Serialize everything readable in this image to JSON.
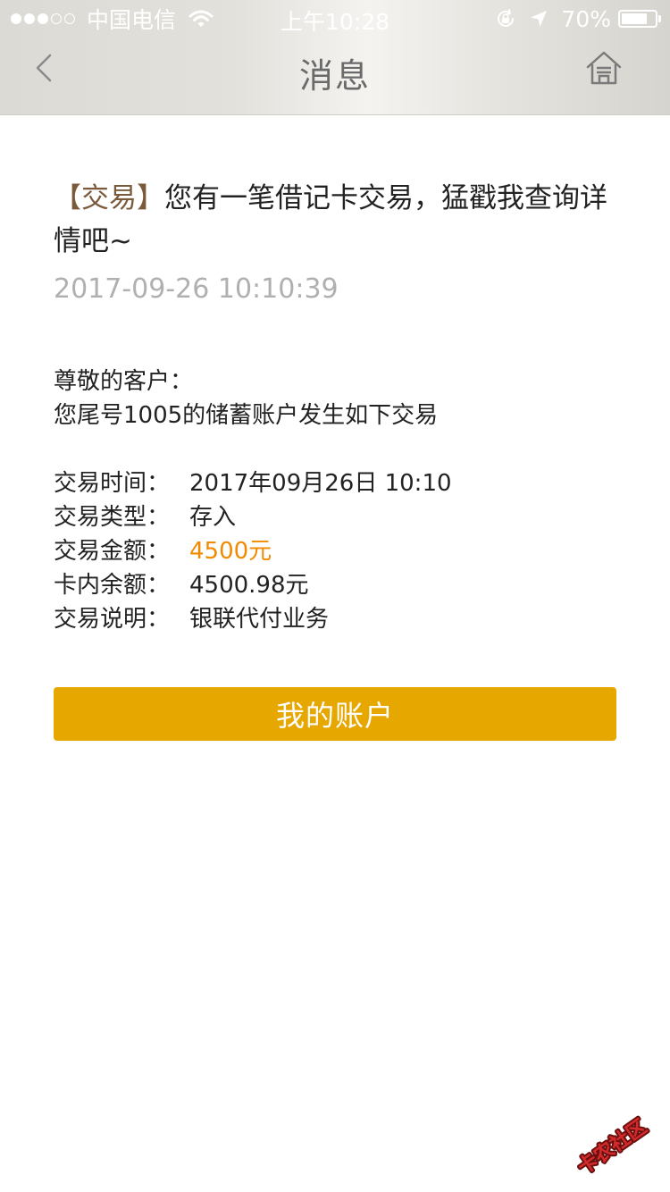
{
  "status_bar": {
    "carrier": "中国电信",
    "time": "上午10:28",
    "battery": "70%",
    "signal_bars_filled": 3,
    "signal_bars_total": 5
  },
  "nav": {
    "title": "消息",
    "back_icon": "chevron-left-icon",
    "home_icon": "home-icon"
  },
  "message": {
    "tag": "【交易】",
    "title": "您有一笔借记卡交易，猛戳我查询详情吧~",
    "time": "2017-09-26 10:10:39",
    "greeting": "尊敬的客户：",
    "intro": "您尾号1005的储蓄账户发生如下交易",
    "details": [
      {
        "label": "交易时间：",
        "value": "2017年09月26日  10:10"
      },
      {
        "label": "交易类型：",
        "value": "存入"
      },
      {
        "label": "交易金额：",
        "value": "4500元"
      },
      {
        "label": "卡内余额：",
        "value": "4500.98元"
      },
      {
        "label": "交易说明：",
        "value": "银联代付业务"
      }
    ]
  },
  "actions": {
    "account_button": "我的账户"
  },
  "watermark": {
    "text": "卡农社区"
  },
  "colors": {
    "accent": "#e6a700",
    "amount": "#f08a00",
    "tag": "#7b5a3c",
    "muted": "#b0b0b0"
  }
}
